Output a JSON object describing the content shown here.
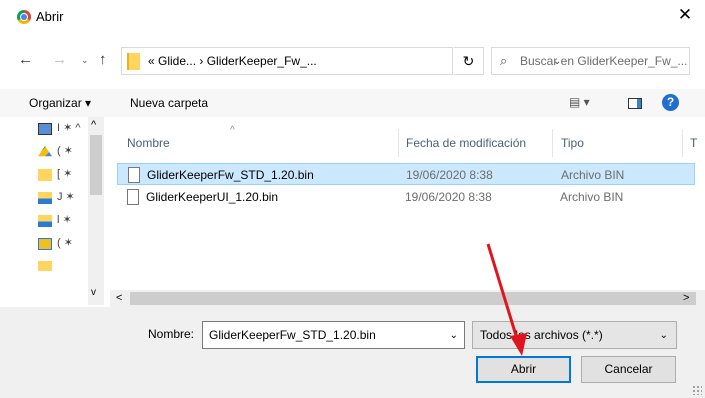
{
  "titlebar": {
    "title": "Abrir",
    "close_glyph": "✕"
  },
  "nav": {
    "back": "←",
    "forward": "→",
    "recent": "⌄",
    "up": "↑",
    "breadcrumb": "« Glide... › GliderKeeper_Fw_...",
    "dropdown": "⌄",
    "refresh": "↻",
    "search_placeholder": "Buscar en GliderKeeper_Fw_..."
  },
  "toolbar": {
    "organize_label": "Organizar ▾",
    "new_folder_label": "Nueva carpeta",
    "view_label": "▤ ▾",
    "help_label": "?"
  },
  "nav_pane": {
    "items": [
      {
        "text": "I ✶ ^",
        "icon_color": "#5a8fd6"
      },
      {
        "text": "( ✶",
        "icon_color": "#34a853"
      },
      {
        "text": "[ ✶",
        "icon_color": "#ffd45f"
      },
      {
        "text": "J ✶",
        "icon_color": "#2b7bd6"
      },
      {
        "text": "l ✶",
        "icon_color": "#2b7bd6"
      },
      {
        "text": "( ✶",
        "icon_color": "#f0c020"
      },
      {
        "text": "",
        "icon_color": "#ffd45f"
      }
    ]
  },
  "columns": {
    "name": "Nombre",
    "date": "Fecha de modificación",
    "type": "Tipo",
    "extra": "T"
  },
  "files": [
    {
      "name": "GliderKeeperFw_STD_1.20.bin",
      "date": "19/06/2020 8:38",
      "type": "Archivo BIN",
      "selected": true
    },
    {
      "name": "GliderKeeperUI_1.20.bin",
      "date": "19/06/2020 8:38",
      "type": "Archivo BIN",
      "selected": false
    }
  ],
  "bottom": {
    "name_label": "Nombre:",
    "name_value": "GliderKeeperFw_STD_1.20.bin",
    "filter_value": "Todos los archivos (*.*)",
    "open_label": "Abrir",
    "cancel_label": "Cancelar"
  },
  "annotation": {
    "arrow_color": "#e0141e"
  }
}
